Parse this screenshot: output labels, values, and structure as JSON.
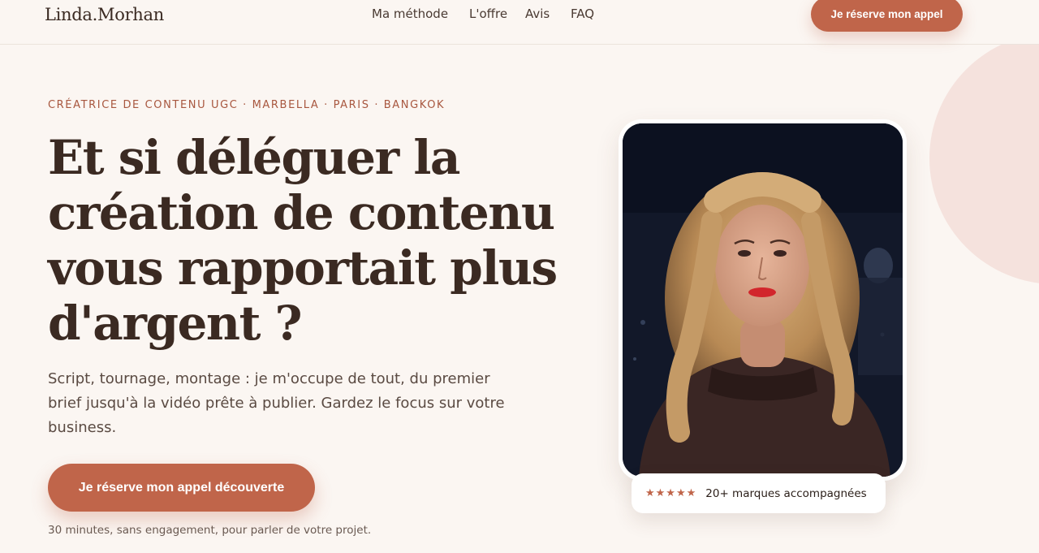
{
  "header": {
    "logo": "Linda.Morhan",
    "nav": [
      {
        "label": "Ma méthode"
      },
      {
        "label": "L'offre"
      },
      {
        "label": "Avis"
      },
      {
        "label": "FAQ"
      }
    ],
    "cta_label": "Je réserve mon appel"
  },
  "hero": {
    "eyebrow": "CRÉATRICE DE CONTENU UGC · MARBELLA · PARIS · BANGKOK",
    "headline_lines": [
      "Et si déléguer la",
      "création de contenu",
      "vous rapportait plus",
      "d'argent ?"
    ],
    "subtext_lines": [
      "Script, tournage, montage : je m'occupe de tout, du premier",
      "brief jusqu'à la vidéo prête à publier. Gardez le focus sur votre",
      "business."
    ],
    "cta_label": "Je réserve mon appel découverte",
    "cta_note": "30 minutes, sans engagement, pour parler de votre projet."
  },
  "badge": {
    "stars": "★★★★★",
    "rating": 5,
    "text": "20+ marques accompagnées"
  },
  "colors": {
    "background": "#fbf6f2",
    "accent": "#c0654a",
    "heading": "#3b2a22",
    "eyebrow": "#a8573f",
    "deco": "#f5e2dd"
  }
}
